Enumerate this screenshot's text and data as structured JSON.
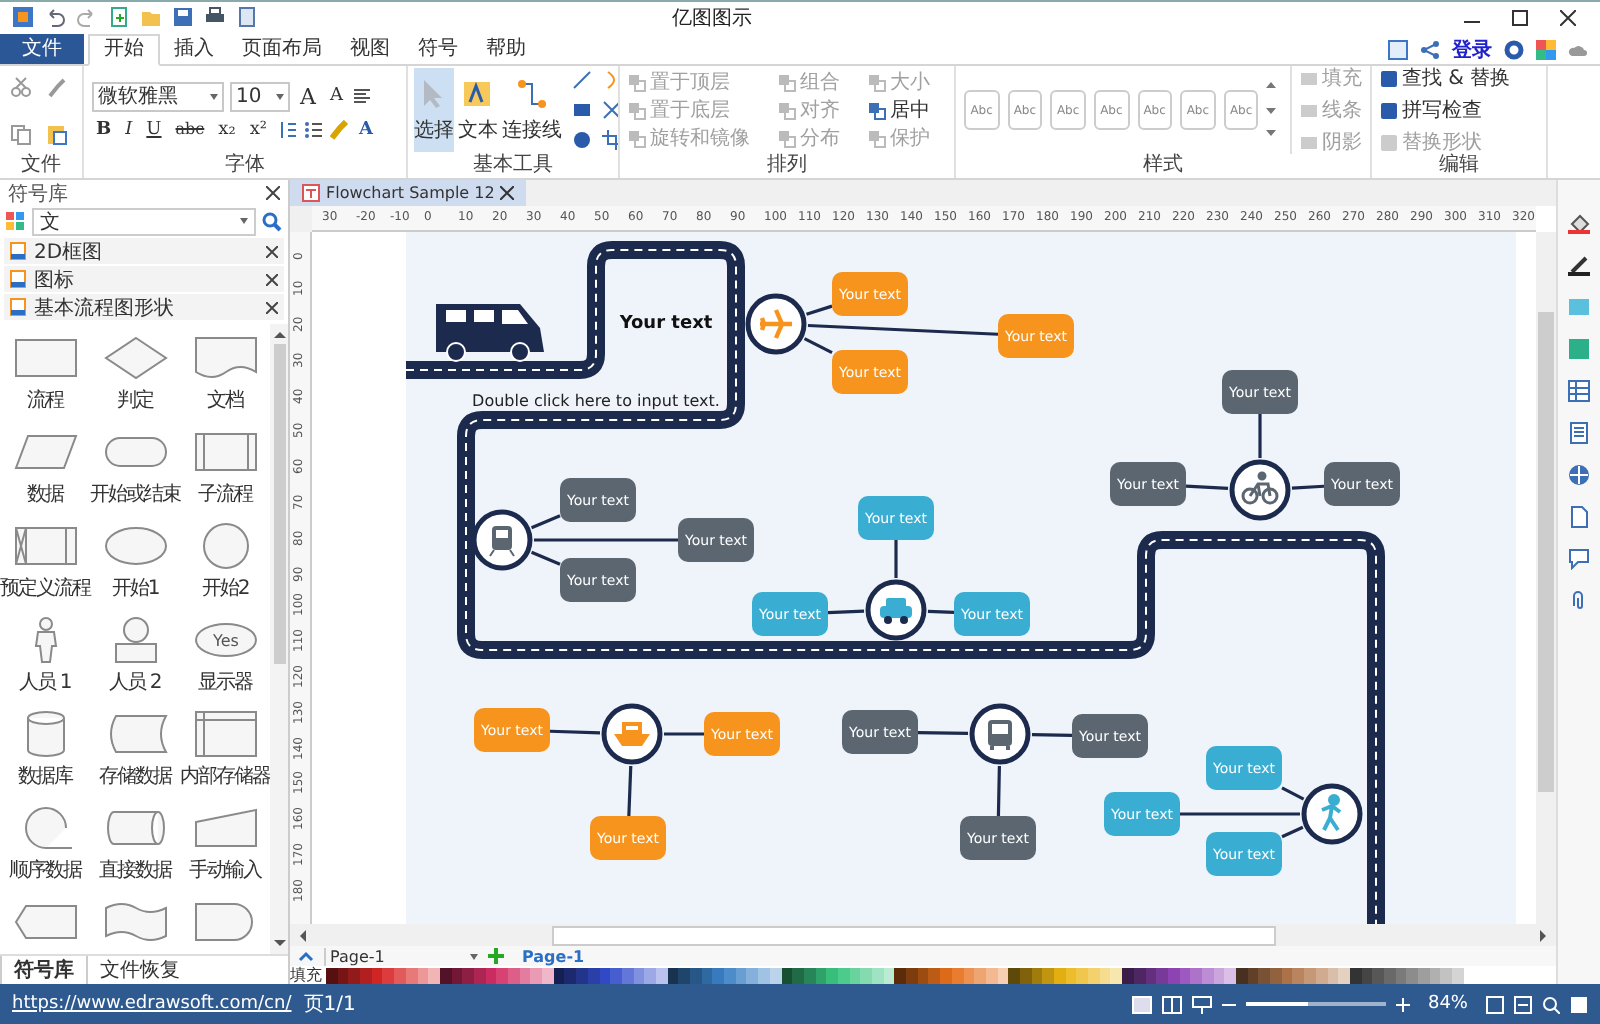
{
  "title_bar": {
    "title": "亿图图示"
  },
  "menu_tabs": [
    {
      "label": "文件",
      "kind": "file",
      "selected": false
    },
    {
      "label": "开始",
      "kind": "tab",
      "selected": true
    },
    {
      "label": "插入",
      "kind": "tab",
      "selected": false
    },
    {
      "label": "页面布局",
      "kind": "tab",
      "selected": false
    },
    {
      "label": "视图",
      "kind": "tab",
      "selected": false
    },
    {
      "label": "符号",
      "kind": "tab",
      "selected": false
    },
    {
      "label": "帮助",
      "kind": "tab",
      "selected": false
    }
  ],
  "account": {
    "login": "登录"
  },
  "ribbon": {
    "file_group": {
      "label": "文件"
    },
    "font_group": {
      "label": "字体",
      "font": "微软雅黑",
      "size": "10",
      "grow_shrink": [
        "A",
        "A"
      ],
      "format_buttons": [
        "B",
        "I",
        "U",
        "abc",
        "x₂",
        "x²"
      ],
      "font_color": "A"
    },
    "tools_group": {
      "label": "基本工具",
      "tools": [
        {
          "label": "选择",
          "kind": "pointer",
          "selected": true
        },
        {
          "label": "文本",
          "kind": "text",
          "selected": false
        },
        {
          "label": "连接线",
          "kind": "connector",
          "selected": false
        }
      ]
    },
    "arrange_group": {
      "label": "排列",
      "items": [
        {
          "label": "置于顶层",
          "disabled": true
        },
        {
          "label": "置于底层",
          "disabled": true
        },
        {
          "label": "旋转和镜像",
          "disabled": true
        },
        {
          "label": "组合",
          "disabled": true
        },
        {
          "label": "对齐",
          "disabled": true
        },
        {
          "label": "分布",
          "disabled": true
        },
        {
          "label": "大小",
          "disabled": true
        },
        {
          "label": "居中",
          "disabled": false
        },
        {
          "label": "保护",
          "disabled": true
        }
      ]
    },
    "style_group": {
      "label": "样式",
      "swatches": [
        "Abc",
        "Abc",
        "Abc",
        "Abc",
        "Abc",
        "Abc",
        "Abc"
      ],
      "options": [
        {
          "label": "填充",
          "disabled": true
        },
        {
          "label": "线条",
          "disabled": true
        },
        {
          "label": "阴影",
          "disabled": true
        }
      ]
    },
    "edit_group": {
      "label": "编辑",
      "items": [
        {
          "label": "查找 & 替换",
          "disabled": false
        },
        {
          "label": "拼写检查",
          "disabled": false
        },
        {
          "label": "替换形状",
          "disabled": true
        }
      ]
    }
  },
  "library": {
    "title": "符号库",
    "search": "文",
    "categories": [
      "2D框图",
      "图标",
      "基本流程图形状"
    ],
    "shapes": [
      {
        "kind": "rectangle",
        "label": "流程"
      },
      {
        "kind": "diamond",
        "label": "判定"
      },
      {
        "kind": "document",
        "label": "文档"
      },
      {
        "kind": "parallelogram",
        "label": "数据"
      },
      {
        "kind": "stadium",
        "label": "开始或结束"
      },
      {
        "kind": "subprocess",
        "label": "子流程"
      },
      {
        "kind": "predefined",
        "label": "预定义流程"
      },
      {
        "kind": "ellipse",
        "label": "开始1"
      },
      {
        "kind": "circle",
        "label": "开始2"
      },
      {
        "kind": "stick-person",
        "label": "人员 1"
      },
      {
        "kind": "person-bust",
        "label": "人员 2"
      },
      {
        "kind": "labeled-ellipse",
        "label": "显示器"
      },
      {
        "kind": "cylinder",
        "label": "数据库"
      },
      {
        "kind": "stored-data",
        "label": "存储数据"
      },
      {
        "kind": "internal-storage",
        "label": "内部存储器"
      },
      {
        "kind": "sequential",
        "label": "顺序数据"
      },
      {
        "kind": "horizontal-cylinder",
        "label": "直接数据"
      },
      {
        "kind": "manual-input",
        "label": "手动输入"
      },
      {
        "kind": "display"
      },
      {
        "kind": "wave"
      },
      {
        "kind": "delay"
      }
    ],
    "ellipse_shape_text": "Yes",
    "bottom_tabs": [
      {
        "label": "符号库",
        "selected": true
      },
      {
        "label": "文件恢复",
        "selected": false
      }
    ]
  },
  "document_tab": {
    "title": "Flowchart Sample 12"
  },
  "ruler": {
    "horizontal": [
      "30",
      "-20",
      "-10",
      "0",
      "10",
      "20",
      "30",
      "40",
      "50",
      "60",
      "70",
      "80",
      "90",
      "100",
      "110",
      "120",
      "130",
      "140",
      "150",
      "160",
      "170",
      "180",
      "190",
      "200",
      "210",
      "220",
      "230",
      "240",
      "250",
      "260",
      "270",
      "280",
      "290",
      "300",
      "310",
      "320"
    ],
    "vertical": [
      "0",
      "10",
      "20",
      "30",
      "40",
      "50",
      "60",
      "70",
      "80",
      "90",
      "100",
      "110",
      "120",
      "130",
      "140",
      "150",
      "160",
      "170",
      "180"
    ]
  },
  "diagram": {
    "title": "Your text",
    "hint": "Double click here to input text.",
    "hubs": [
      {
        "kind": "plane",
        "color": "#f7941d",
        "labels": [
          "Your text",
          "Your text",
          "Your text"
        ]
      },
      {
        "kind": "bike",
        "color": "#5b6670",
        "labels": [
          "Your text",
          "Your text",
          "Your text"
        ]
      },
      {
        "kind": "train",
        "color": "#5b6670",
        "labels": [
          "Your text",
          "Your text",
          "Your text"
        ]
      },
      {
        "kind": "car",
        "color": "#3aaed2",
        "labels": [
          "Your text",
          "Your text",
          "Your text"
        ]
      },
      {
        "kind": "boat",
        "color": "#f7941d",
        "labels": [
          "Your text",
          "Your text",
          "Your text"
        ]
      },
      {
        "kind": "bus",
        "color": "#5b6670",
        "labels": [
          "Your text",
          "Your text",
          "Your text"
        ]
      },
      {
        "kind": "walker",
        "color": "#3aaed2",
        "labels": [
          "Your text",
          "Your text",
          "Your text"
        ]
      }
    ]
  },
  "page_bar": {
    "dropdown": "Page-1",
    "tabs": [
      {
        "label": "Page-1",
        "selected": true
      }
    ]
  },
  "palette": {
    "label": "填充"
  },
  "status_bar": {
    "link": "https://www.edrawsoft.com/cn/",
    "page": "页1/1",
    "zoom": "84%",
    "zoom_slider": {
      "level": 0.45
    }
  }
}
